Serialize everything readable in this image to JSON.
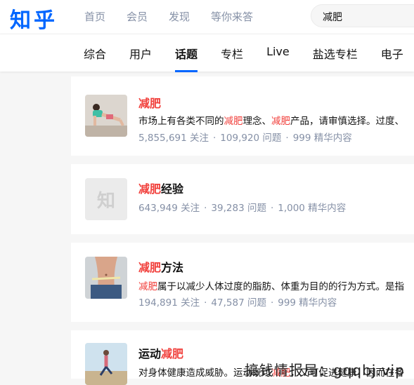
{
  "header": {
    "logo": "知乎",
    "nav": [
      "首页",
      "会员",
      "发现",
      "等你来答"
    ],
    "search_value": "减肥"
  },
  "tabs": {
    "items": [
      "综合",
      "用户",
      "话题",
      "专栏",
      "Live",
      "盐选专栏",
      "电子"
    ],
    "active": "话题"
  },
  "results": [
    {
      "title_hl": "减肥",
      "title_rest": "",
      "desc_parts": [
        "市场上有各类不同的",
        "减肥",
        "理念、",
        "减肥",
        "产品，请审慎选择。过度、"
      ],
      "followers": "5,855,691 关注",
      "questions": "109,920 问题",
      "essence": "999 精华内容"
    },
    {
      "title_hl": "减肥",
      "title_rest": "经验",
      "placeholder": "知",
      "followers": "643,949 关注",
      "questions": "39,283 问题",
      "essence": "1,000 精华内容"
    },
    {
      "title_hl": "减肥",
      "title_rest": "方法",
      "desc_parts": [
        "减肥",
        "属于以减少人体过度的脂肪、体重为目的的行为方式。是指"
      ],
      "followers": "194,891 关注",
      "questions": "47,587 问题",
      "essence": "999 精华内容"
    },
    {
      "title_pre": "运动",
      "title_hl": "减肥",
      "desc_parts": [
        "对身体健康造成威胁。运动既可",
        "减肥",
        "，又可促进健康，因而在各"
      ]
    }
  ],
  "separator": "·",
  "watermark": "搞钱情报局：gqqbj.vip",
  "colors": {
    "brand": "#0066ff",
    "highlight": "#f1403c",
    "meta": "#8590a6"
  },
  "icons": [
    "plank-workout-photo",
    "zhihu-placeholder-icon",
    "waist-measure-photo",
    "running-photo"
  ]
}
